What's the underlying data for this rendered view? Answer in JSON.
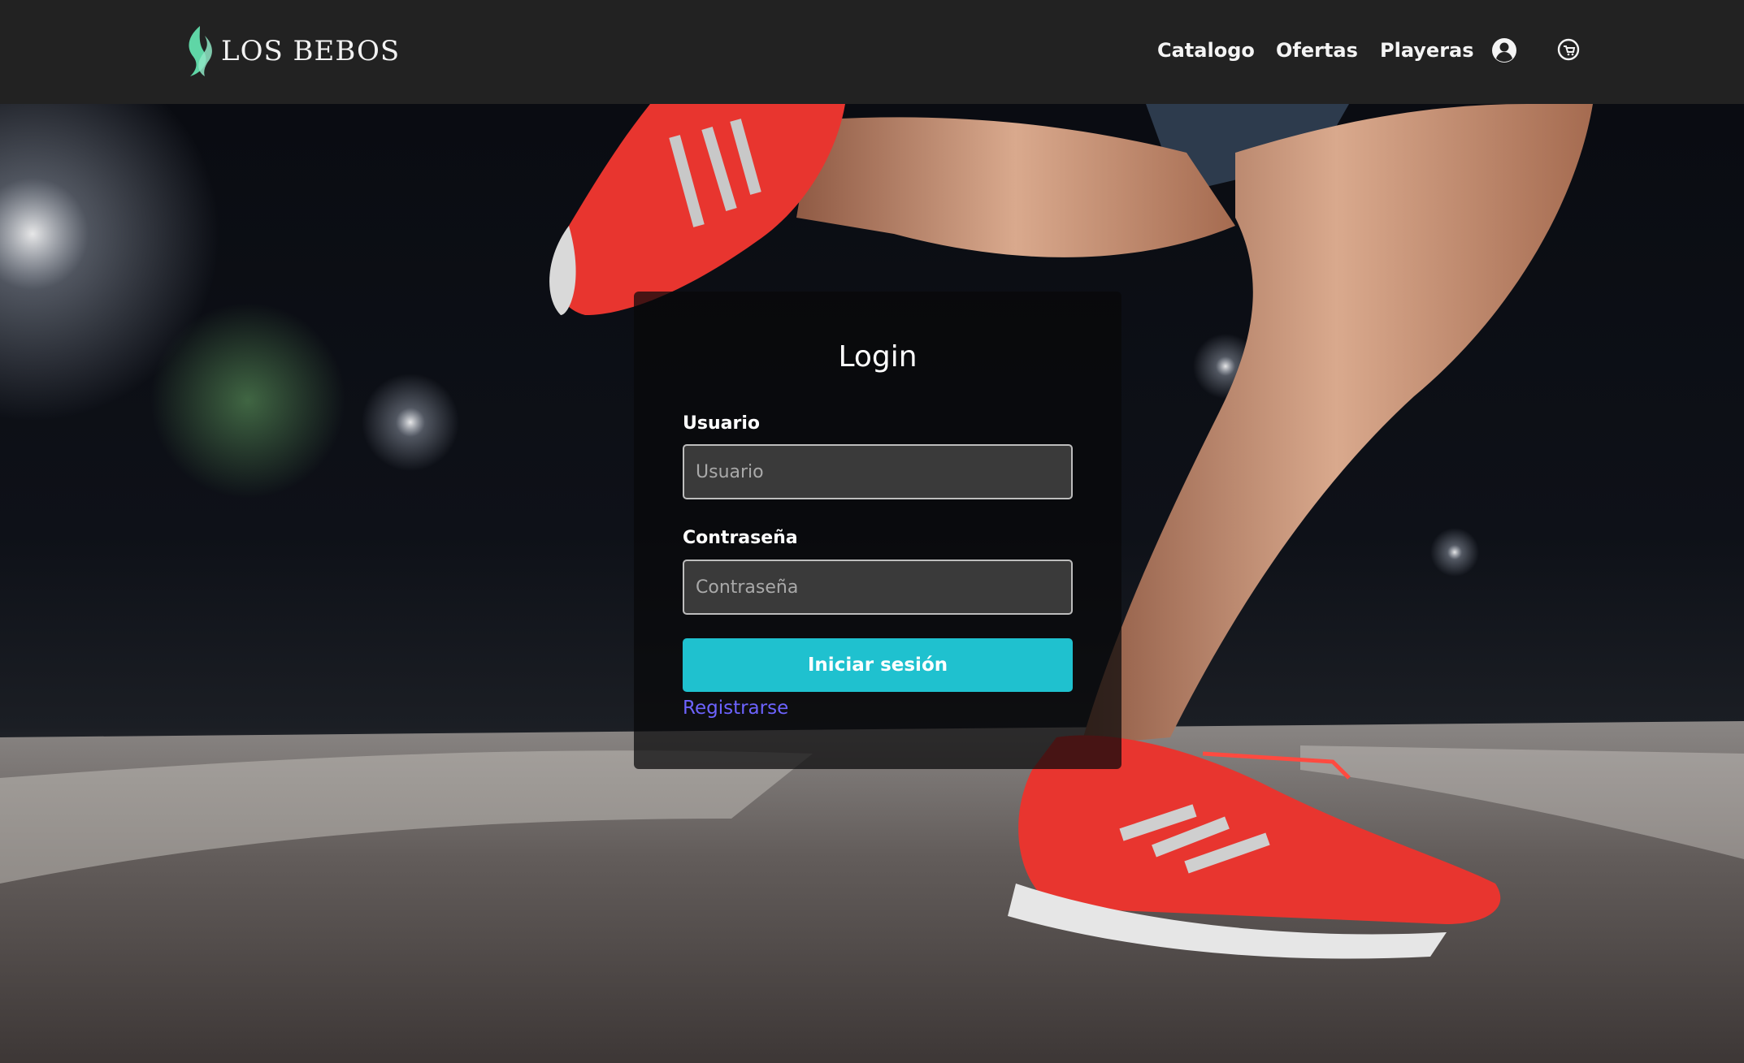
{
  "brand": {
    "name": "LOS BEBOS",
    "logo_icon": "flame-leaf-logo",
    "logo_color": "#5fd6a6"
  },
  "nav": {
    "items": [
      {
        "label": "Catalogo"
      },
      {
        "label": "Ofertas"
      },
      {
        "label": "Playeras"
      }
    ],
    "user_icon": "user-circle-icon",
    "cart_icon": "cart-icon"
  },
  "login": {
    "title": "Login",
    "username": {
      "label": "Usuario",
      "placeholder": "Usuario",
      "value": ""
    },
    "password": {
      "label": "Contraseña",
      "placeholder": "Contraseña",
      "value": ""
    },
    "submit_label": "Iniciar sesión",
    "register_label": "Registrarse"
  },
  "colors": {
    "navbar": "#222222",
    "accent_button": "#1fc1cf",
    "link": "#6d63ff"
  }
}
